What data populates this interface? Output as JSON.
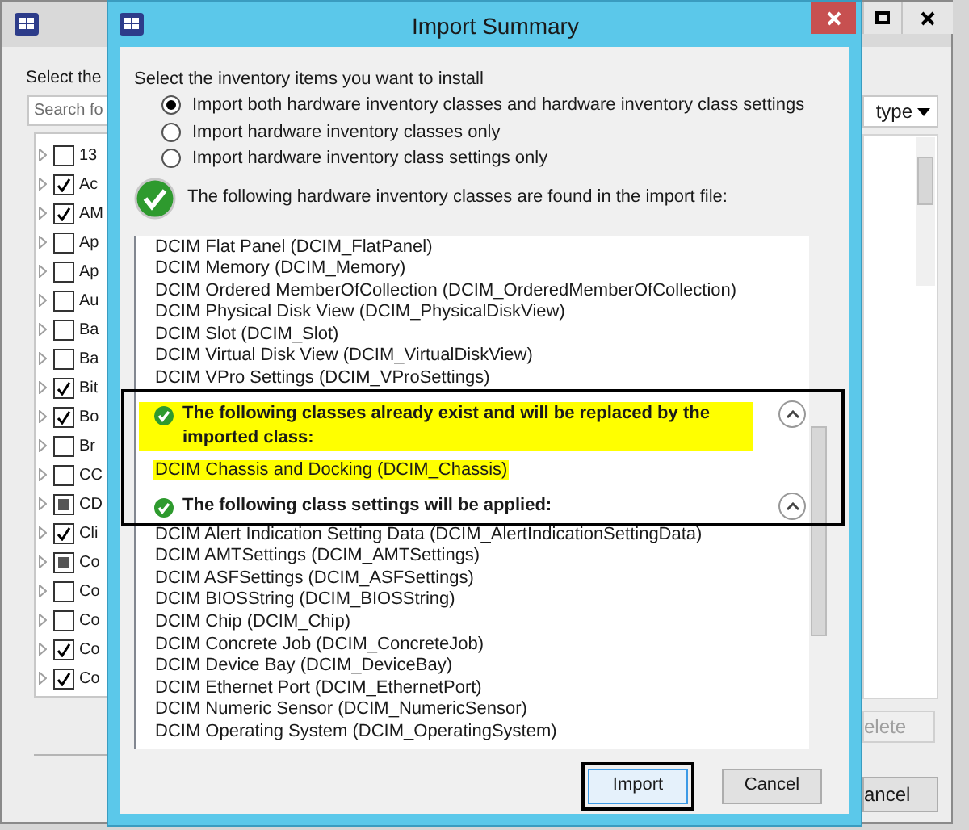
{
  "background_window": {
    "heading": "Select the",
    "search_placeholder": "Search fo",
    "tree": [
      {
        "label": "13",
        "checked": false,
        "indeterminate": false
      },
      {
        "label": "Ac",
        "checked": true,
        "indeterminate": false
      },
      {
        "label": "AM",
        "checked": true,
        "indeterminate": false
      },
      {
        "label": "Ap",
        "checked": false,
        "indeterminate": false
      },
      {
        "label": "Ap",
        "checked": false,
        "indeterminate": false
      },
      {
        "label": "Au",
        "checked": false,
        "indeterminate": false
      },
      {
        "label": "Ba",
        "checked": false,
        "indeterminate": false
      },
      {
        "label": "Ba",
        "checked": false,
        "indeterminate": false
      },
      {
        "label": "Bit",
        "checked": true,
        "indeterminate": false
      },
      {
        "label": "Bo",
        "checked": true,
        "indeterminate": false
      },
      {
        "label": "Br",
        "checked": false,
        "indeterminate": false
      },
      {
        "label": "CC",
        "checked": false,
        "indeterminate": false
      },
      {
        "label": "CD",
        "checked": false,
        "indeterminate": true
      },
      {
        "label": "Cli",
        "checked": true,
        "indeterminate": false
      },
      {
        "label": "Co",
        "checked": false,
        "indeterminate": true
      },
      {
        "label": "Co",
        "checked": false,
        "indeterminate": false
      },
      {
        "label": "Co",
        "checked": false,
        "indeterminate": false
      },
      {
        "label": "Co",
        "checked": true,
        "indeterminate": false
      },
      {
        "label": "Co",
        "checked": true,
        "indeterminate": false
      }
    ],
    "dropdown": "type",
    "delete_button": "elete",
    "cancel_button": "ancel"
  },
  "dialog": {
    "title": "Import Summary",
    "prompt": "Select the inventory items you want to install",
    "options": [
      {
        "label": "Import both hardware inventory classes and hardware inventory class settings",
        "selected": true
      },
      {
        "label": "Import hardware inventory classes only",
        "selected": false
      },
      {
        "label": "Import hardware inventory class settings only",
        "selected": false
      }
    ],
    "found_message": "The following hardware inventory classes are found in the import file:",
    "list": [
      {
        "kind": "item",
        "text": "DCIM Flat Panel (DCIM_FlatPanel)",
        "highlighted": false
      },
      {
        "kind": "item",
        "text": "DCIM Memory (DCIM_Memory)",
        "highlighted": false
      },
      {
        "kind": "item",
        "text": "DCIM Ordered MemberOfCollection  (DCIM_OrderedMemberOfCollection)",
        "highlighted": false
      },
      {
        "kind": "item",
        "text": "DCIM Physical Disk View (DCIM_PhysicalDiskView)",
        "highlighted": false
      },
      {
        "kind": "item",
        "text": "DCIM Slot (DCIM_Slot)",
        "highlighted": false
      },
      {
        "kind": "item",
        "text": "DCIM Virtual Disk View (DCIM_VirtualDiskView)",
        "highlighted": false
      },
      {
        "kind": "item",
        "text": "DCIM VPro Settings (DCIM_VProSettings)",
        "highlighted": false
      },
      {
        "kind": "header",
        "text": "The following classes already exist and will be replaced by the imported class:",
        "highlighted": true,
        "expanded": true
      },
      {
        "kind": "item",
        "text": "DCIM Chassis and Docking (DCIM_Chassis)",
        "highlighted": true
      },
      {
        "kind": "header",
        "text": "The following class settings will be applied:",
        "highlighted": false,
        "expanded": true
      },
      {
        "kind": "item",
        "text": "DCIM Alert Indication Setting Data (DCIM_AlertIndicationSettingData)",
        "highlighted": false
      },
      {
        "kind": "item",
        "text": "DCIM AMTSettings (DCIM_AMTSettings)",
        "highlighted": false
      },
      {
        "kind": "item",
        "text": "DCIM ASFSettings (DCIM_ASFSettings)",
        "highlighted": false
      },
      {
        "kind": "item",
        "text": "DCIM BIOSString (DCIM_BIOSString)",
        "highlighted": false
      },
      {
        "kind": "item",
        "text": "DCIM Chip (DCIM_Chip)",
        "highlighted": false
      },
      {
        "kind": "item",
        "text": "DCIM Concrete Job (DCIM_ConcreteJob)",
        "highlighted": false
      },
      {
        "kind": "item",
        "text": "DCIM Device Bay (DCIM_DeviceBay)",
        "highlighted": false
      },
      {
        "kind": "item",
        "text": "DCIM Ethernet Port (DCIM_EthernetPort)",
        "highlighted": false
      },
      {
        "kind": "item",
        "text": "DCIM Numeric Sensor (DCIM_NumericSensor)",
        "highlighted": false
      },
      {
        "kind": "item",
        "text": "DCIM Operating System (DCIM_OperatingSystem)",
        "highlighted": false
      }
    ],
    "buttons": [
      {
        "label": "Import",
        "focused": true
      },
      {
        "label": "Cancel",
        "focused": false
      }
    ]
  }
}
